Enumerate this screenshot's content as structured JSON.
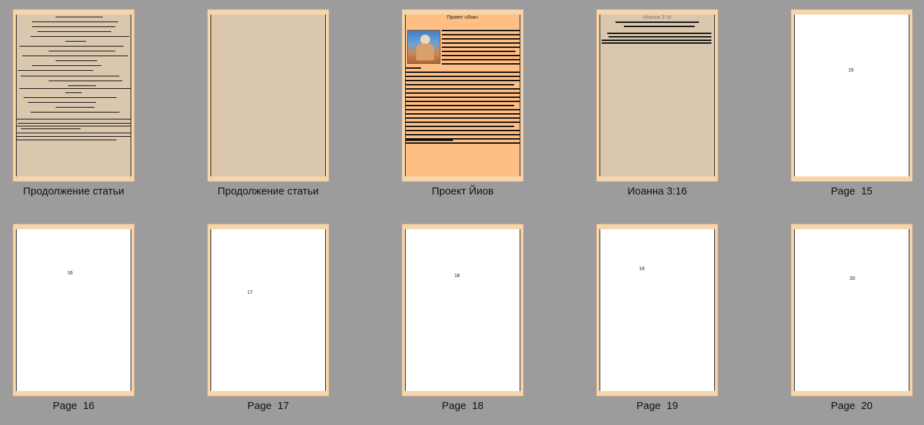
{
  "pages": [
    {
      "caption": "Продолжение статьи",
      "kind": "text-tan"
    },
    {
      "caption": "Продолжение статьи",
      "kind": "blank-tan"
    },
    {
      "caption": "Проект Йиов",
      "kind": "article-orange",
      "inner_title": "Проект «Йов»"
    },
    {
      "caption": "Иоанна 3:16",
      "kind": "verse-tan",
      "inner_title": "Иоанна 3:16"
    },
    {
      "caption": "Page  15",
      "kind": "numbered-white",
      "number": "15"
    },
    {
      "caption": "Page  16",
      "kind": "numbered-white",
      "number": "16"
    },
    {
      "caption": "Page  17",
      "kind": "numbered-white",
      "number": "17"
    },
    {
      "caption": "Page  18",
      "kind": "numbered-white",
      "number": "18"
    },
    {
      "caption": "Page  19",
      "kind": "numbered-white",
      "number": "19"
    },
    {
      "caption": "Page  20",
      "kind": "numbered-white",
      "number": "20"
    }
  ],
  "colors": {
    "background": "#9c9c9c",
    "frame": "#f6d5ad",
    "tan": "#dbc7ad",
    "orange": "#ffbe83",
    "white": "#ffffff"
  }
}
